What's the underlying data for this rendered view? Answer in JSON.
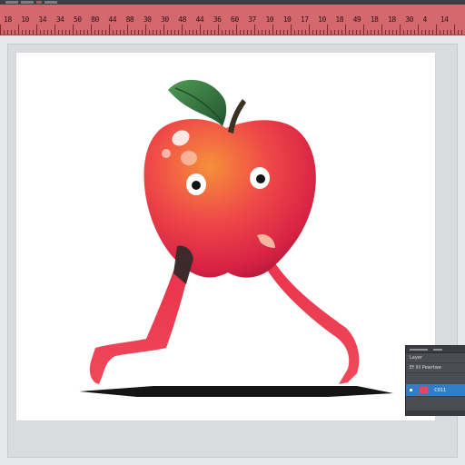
{
  "ruler": {
    "labels": [
      "18",
      "10",
      "14",
      "34",
      "50",
      "80",
      "44",
      "88",
      "30",
      "30",
      "48",
      "44",
      "36",
      "60",
      "37",
      "10",
      "10",
      "17",
      "10",
      "18",
      "49",
      "18",
      "18",
      "30",
      "4",
      "14"
    ]
  },
  "layers_panel": {
    "header_text": "Layer",
    "row_label": "Ef  Iill  Pewrtwe",
    "selected_layer": {
      "name": "C011",
      "swatch_color": "#e24a5b"
    }
  },
  "colors": {
    "ruler_bg": "#d3686f",
    "apple_red": "#e8304a",
    "apple_orange": "#f17d3a",
    "leaf_green": "#2f6b3c",
    "selection_blue": "#2f7fc8"
  }
}
